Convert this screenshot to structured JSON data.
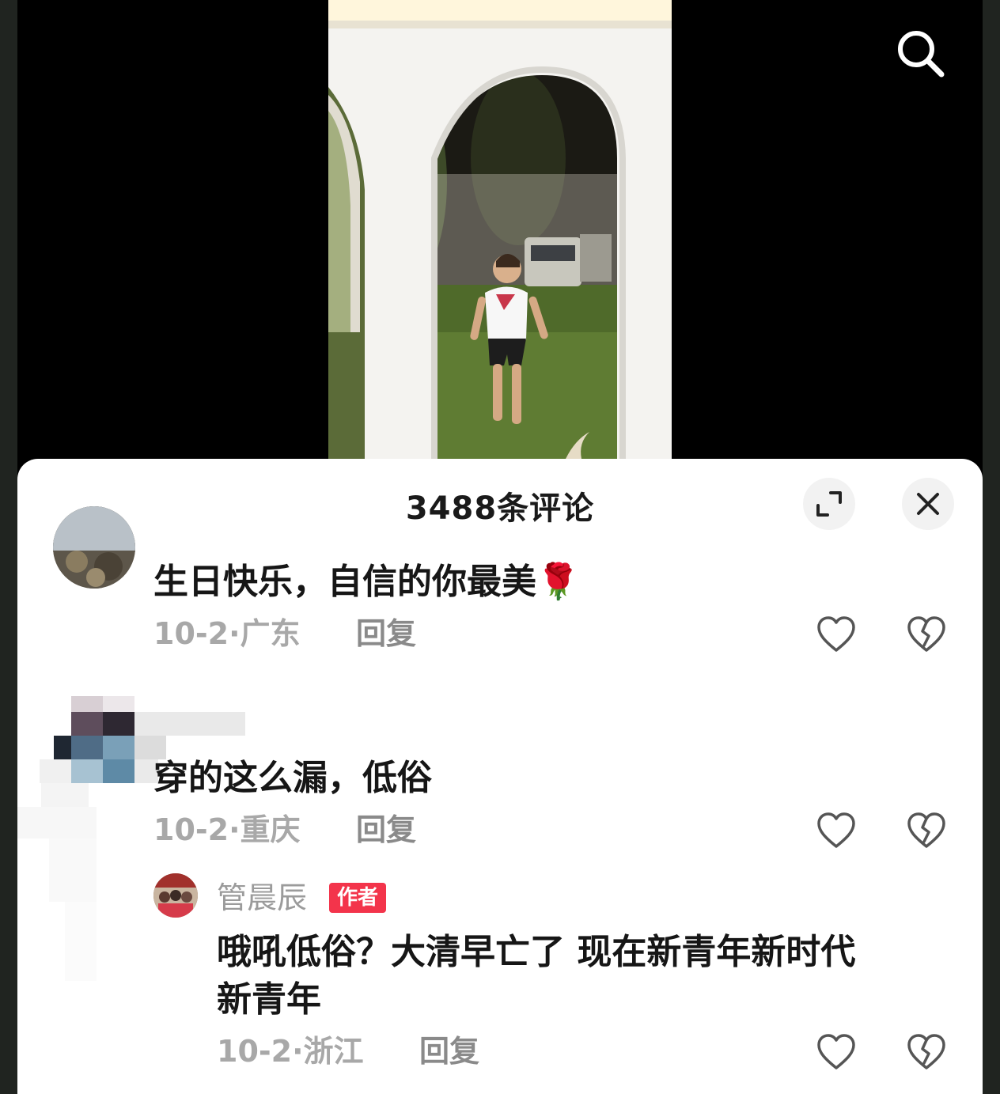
{
  "video": {
    "search_icon": "search-icon"
  },
  "sheet": {
    "title": "3488条评论",
    "expand_icon": "expand-icon",
    "close_icon": "close-icon"
  },
  "comments": [
    {
      "text": "生日快乐，自信的你最美",
      "emoji": "🌹",
      "date": "10-2",
      "location": "广东",
      "reply_label": "回复"
    },
    {
      "text": "穿的这么漏，低俗",
      "date": "10-2",
      "location": "重庆",
      "reply_label": "回复",
      "replies": [
        {
          "author": "管晨辰",
          "badge": "作者",
          "text_line1": "哦吼低俗？大清早亡了 现在新青年新时代",
          "text_line2": "新青年",
          "date": "10-2",
          "location": "浙江",
          "reply_label": "回复"
        }
      ]
    }
  ],
  "colors": {
    "badge": "#f3344b",
    "meta_gray": "#a8a8a8",
    "text_dark": "#161616"
  }
}
